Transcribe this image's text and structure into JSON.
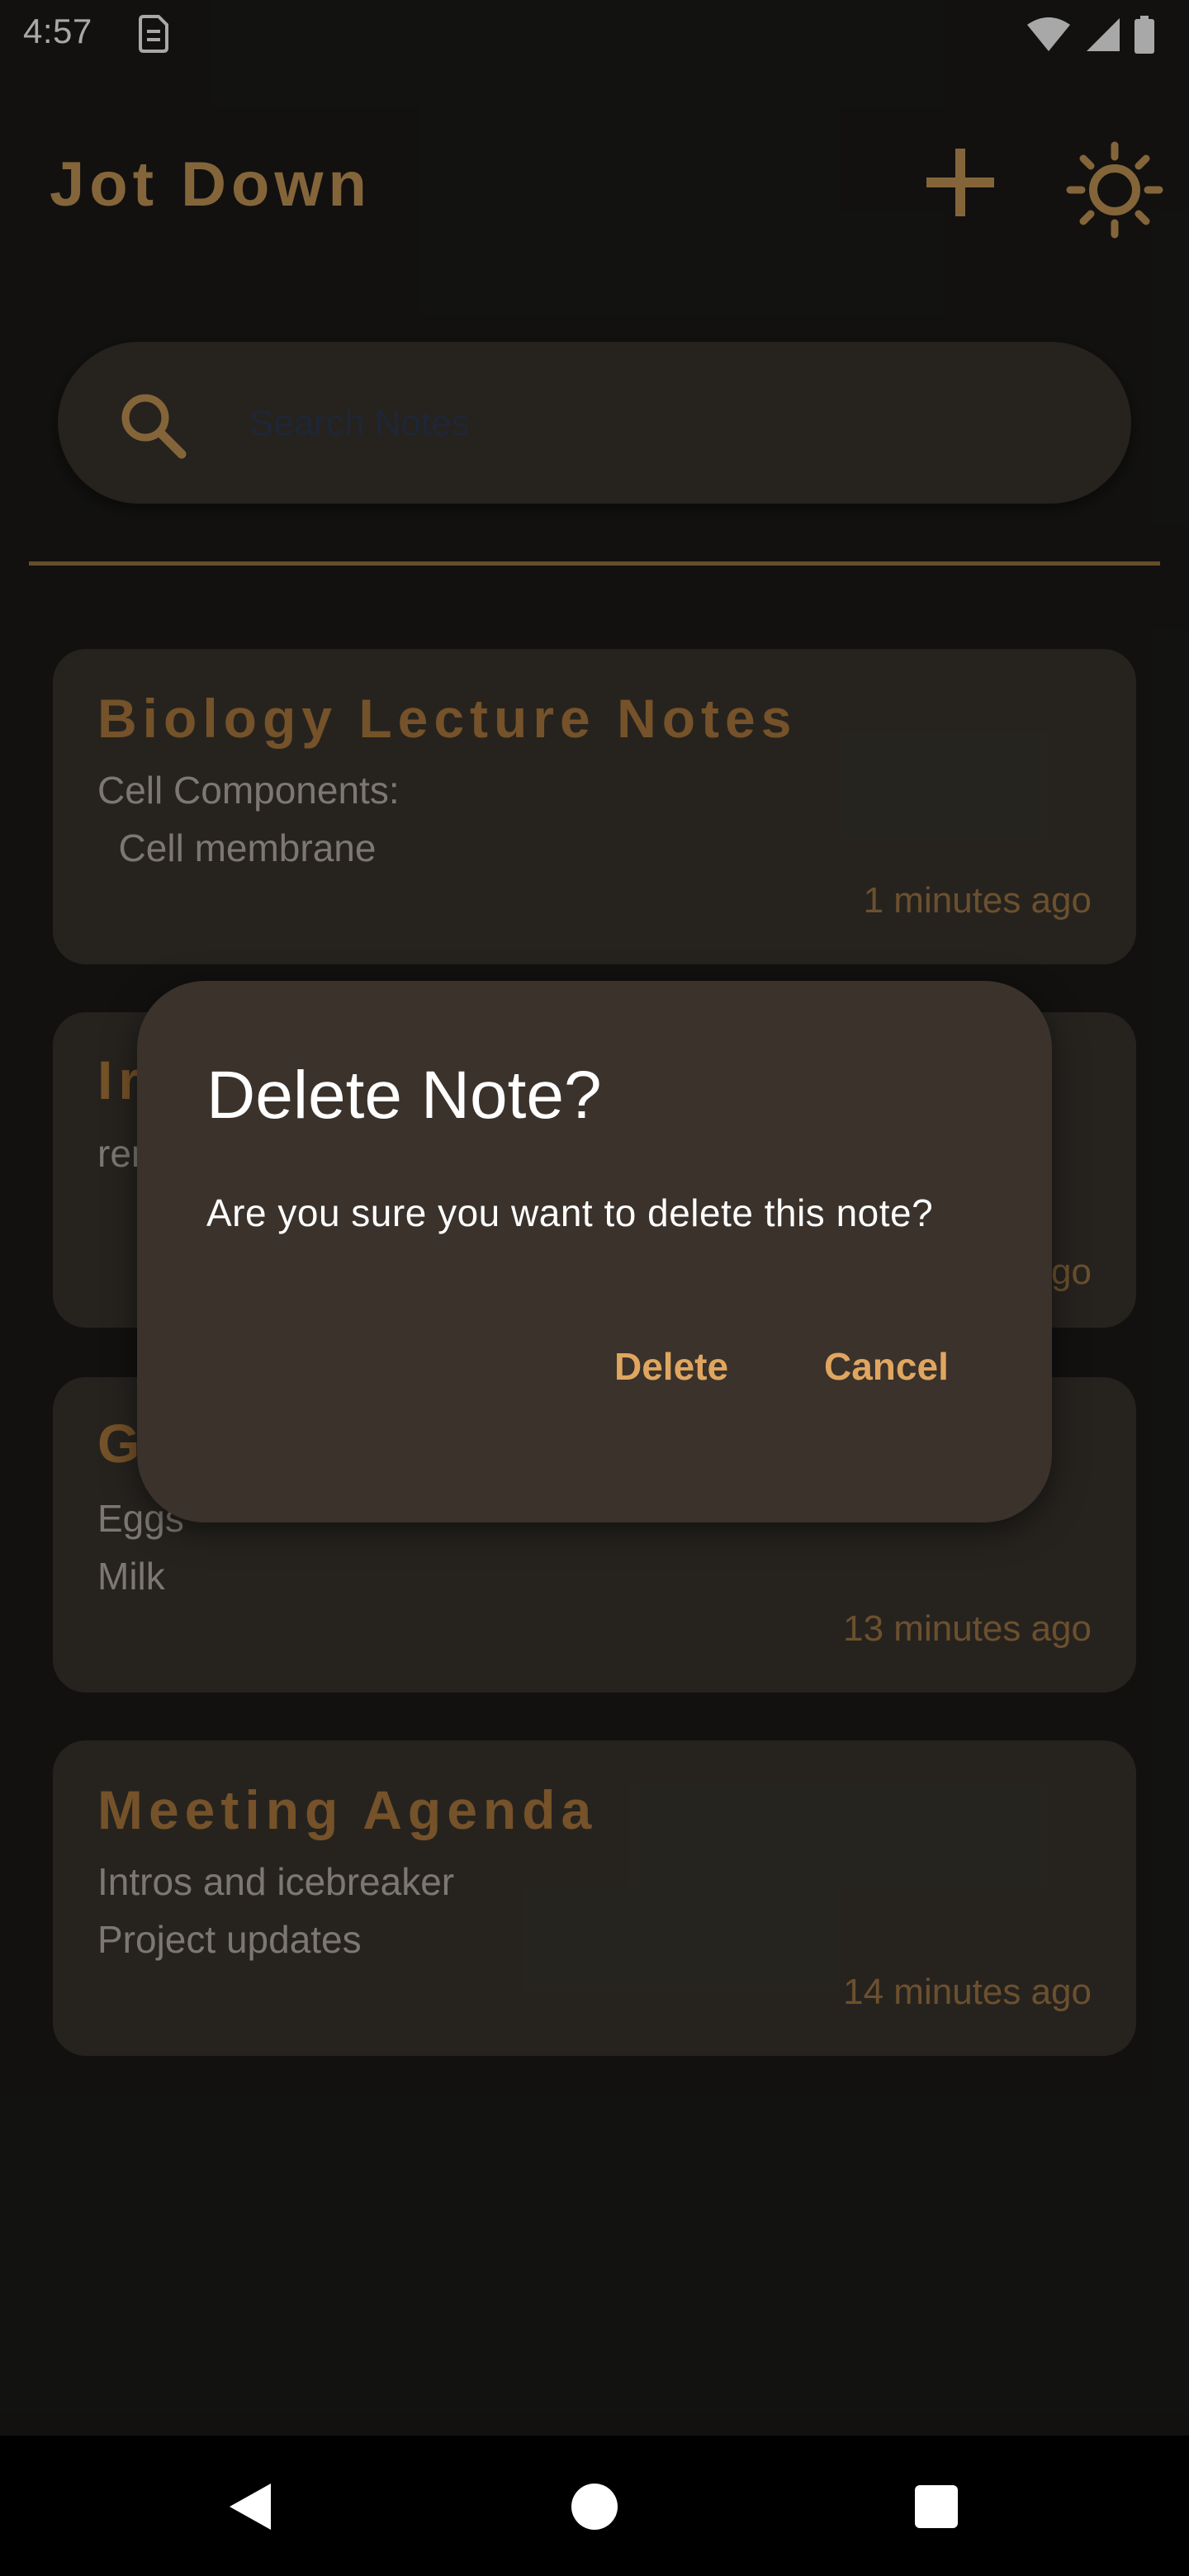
{
  "status_bar": {
    "time": "4:57",
    "icons": [
      "sim-card-icon",
      "wifi-icon",
      "signal-icon",
      "battery-icon"
    ]
  },
  "app_bar": {
    "title": "Jot Down",
    "add_icon": "plus-icon",
    "theme_icon": "sun-icon"
  },
  "search": {
    "placeholder": "Search Notes",
    "value": "",
    "icon": "search-icon"
  },
  "notes": [
    {
      "title": "Biology Lecture Notes",
      "lines": [
        "Cell Components:",
        "  Cell membrane"
      ],
      "time": "1 minutes ago"
    },
    {
      "title": "Ir",
      "lines": [
        "rer"
      ],
      "time": "go"
    },
    {
      "title": "G",
      "lines": [
        "Eggs",
        "Milk"
      ],
      "time": "13 minutes ago"
    },
    {
      "title": "Meeting Agenda",
      "lines": [
        "Intros and icebreaker",
        "Project updates"
      ],
      "time": "14 minutes ago"
    }
  ],
  "dialog": {
    "title": "Delete Note?",
    "message": "Are you sure you want to delete this note?",
    "delete_label": "Delete",
    "cancel_label": "Cancel"
  },
  "colors": {
    "accent": "#c89a58",
    "dialog_button": "#e0a660",
    "card": "#3a362f",
    "dialog_bg": "#3a322b"
  },
  "nav_bar": {
    "icons": [
      "back-icon",
      "home-icon",
      "recents-icon"
    ]
  }
}
